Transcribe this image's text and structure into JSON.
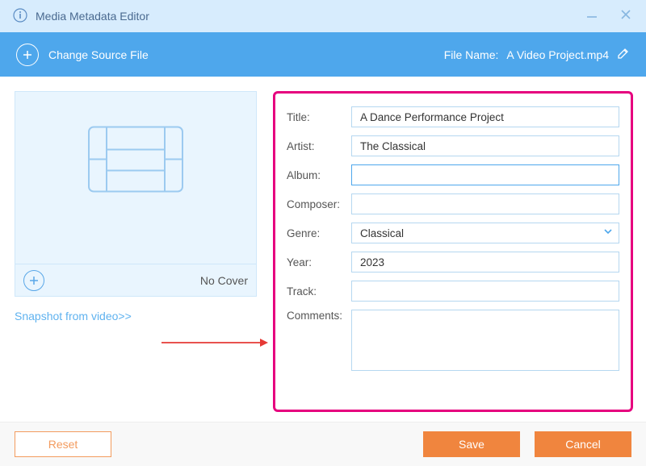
{
  "titlebar": {
    "title": "Media Metadata Editor"
  },
  "toolbar": {
    "change_source": "Change Source File",
    "file_name_label": "File Name:",
    "file_name_value": "A Video Project.mp4"
  },
  "cover": {
    "no_cover": "No Cover",
    "snapshot_link": "Snapshot from video>>"
  },
  "form": {
    "labels": {
      "title": "Title:",
      "artist": "Artist:",
      "album": "Album:",
      "composer": "Composer:",
      "genre": "Genre:",
      "year": "Year:",
      "track": "Track:",
      "comments": "Comments:"
    },
    "values": {
      "title": "A Dance Performance Project",
      "artist": "The Classical",
      "album": "",
      "composer": "",
      "genre": "Classical",
      "year": "2023",
      "track": "",
      "comments": ""
    }
  },
  "footer": {
    "reset": "Reset",
    "save": "Save",
    "cancel": "Cancel"
  }
}
